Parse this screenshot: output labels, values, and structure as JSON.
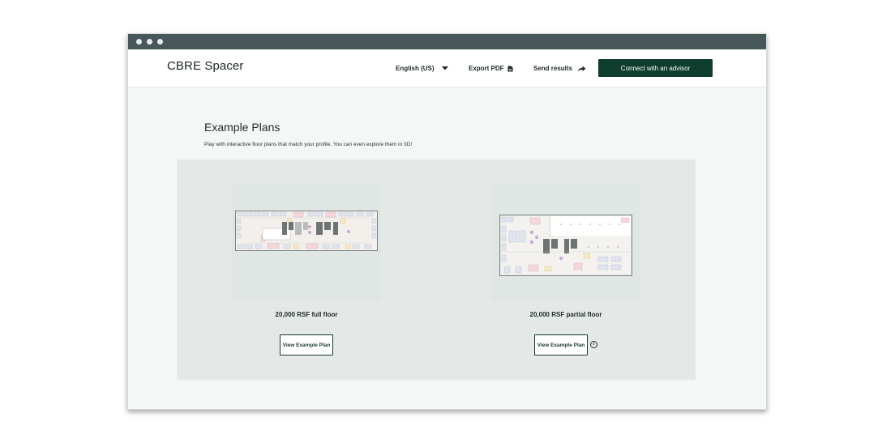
{
  "window": {
    "controls": [
      "close-dot",
      "minimize-dot",
      "maximize-dot"
    ]
  },
  "header": {
    "brand": "CBRE Spacer",
    "language": "English (US)",
    "export_label": "Export PDF",
    "send_label": "Send results",
    "cta_label": "Connect with an advisor"
  },
  "section": {
    "title": "Example Plans",
    "subtitle": "Play with interactive floor plans that match your profile. You can even explore them in 3D!"
  },
  "plans": [
    {
      "label": "20,000 RSF full floor",
      "button": "View Example Plan"
    },
    {
      "label": "20,000 RSF partial floor",
      "button": "View Example Plan",
      "info_icon": "i"
    }
  ],
  "colors": {
    "titlebar": "#47575a",
    "accent": "#0f3d2e",
    "panel": "#e4e9e8",
    "page_bg": "#f5f7f6"
  },
  "icons": {
    "language_caret": "caret-down-icon",
    "export": "document-icon",
    "send": "share-arrow-icon",
    "info": "info-icon"
  }
}
